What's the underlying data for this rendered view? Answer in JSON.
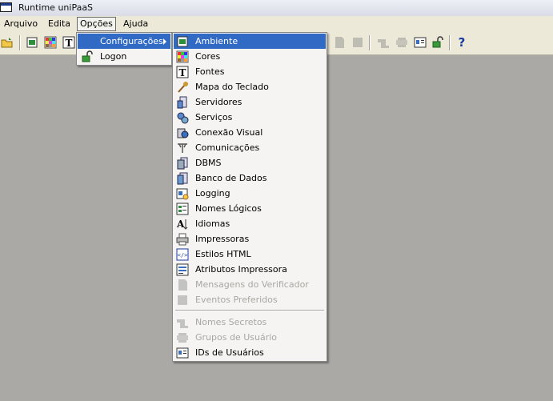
{
  "window": {
    "title": "Runtime uniPaaS"
  },
  "menubar": {
    "items": [
      {
        "label": "Arquivo"
      },
      {
        "label": "Edita"
      },
      {
        "label": "Opções"
      },
      {
        "label": "Ajuda"
      }
    ]
  },
  "options_menu": {
    "items": [
      {
        "label": "Configurações",
        "icon": "settings-icon"
      },
      {
        "label": "Logon",
        "icon": "lock-icon"
      }
    ]
  },
  "config_submenu": {
    "items": [
      {
        "label": "Ambiente",
        "icon": "environment-icon"
      },
      {
        "label": "Cores",
        "icon": "colors-icon"
      },
      {
        "label": "Fontes",
        "icon": "fonts-icon"
      },
      {
        "label": "Mapa do Teclado",
        "icon": "keyboard-map-icon"
      },
      {
        "label": "Servidores",
        "icon": "servers-icon"
      },
      {
        "label": "Serviços",
        "icon": "services-icon"
      },
      {
        "label": "Conexão Visual",
        "icon": "visual-connection-icon"
      },
      {
        "label": "Comunicações",
        "icon": "communications-icon"
      },
      {
        "label": "DBMS",
        "icon": "dbms-icon"
      },
      {
        "label": "Banco de Dados",
        "icon": "database-icon"
      },
      {
        "label": "Logging",
        "icon": "logging-icon"
      },
      {
        "label": "Nomes Lógicos",
        "icon": "logical-names-icon"
      },
      {
        "label": "Idiomas",
        "icon": "languages-icon"
      },
      {
        "label": "Impressoras",
        "icon": "printers-icon"
      },
      {
        "label": "Estilos HTML",
        "icon": "html-styles-icon"
      },
      {
        "label": "Atributos Impressora",
        "icon": "printer-attributes-icon"
      },
      {
        "label": "Mensagens do Verificador",
        "icon": "checker-messages-icon"
      },
      {
        "label": "Eventos Preferidos",
        "icon": "preferred-events-icon"
      },
      {
        "label": "Nomes Secretos",
        "icon": "secret-names-icon"
      },
      {
        "label": "Grupos de Usuário",
        "icon": "user-groups-icon"
      },
      {
        "label": "IDs de Usuários",
        "icon": "user-ids-icon"
      }
    ]
  },
  "toolbar": {
    "help_label": "?"
  },
  "colors": {
    "highlight": "#316ac5",
    "desktop": "#aba9a6",
    "chrome": "#ece9d8"
  }
}
